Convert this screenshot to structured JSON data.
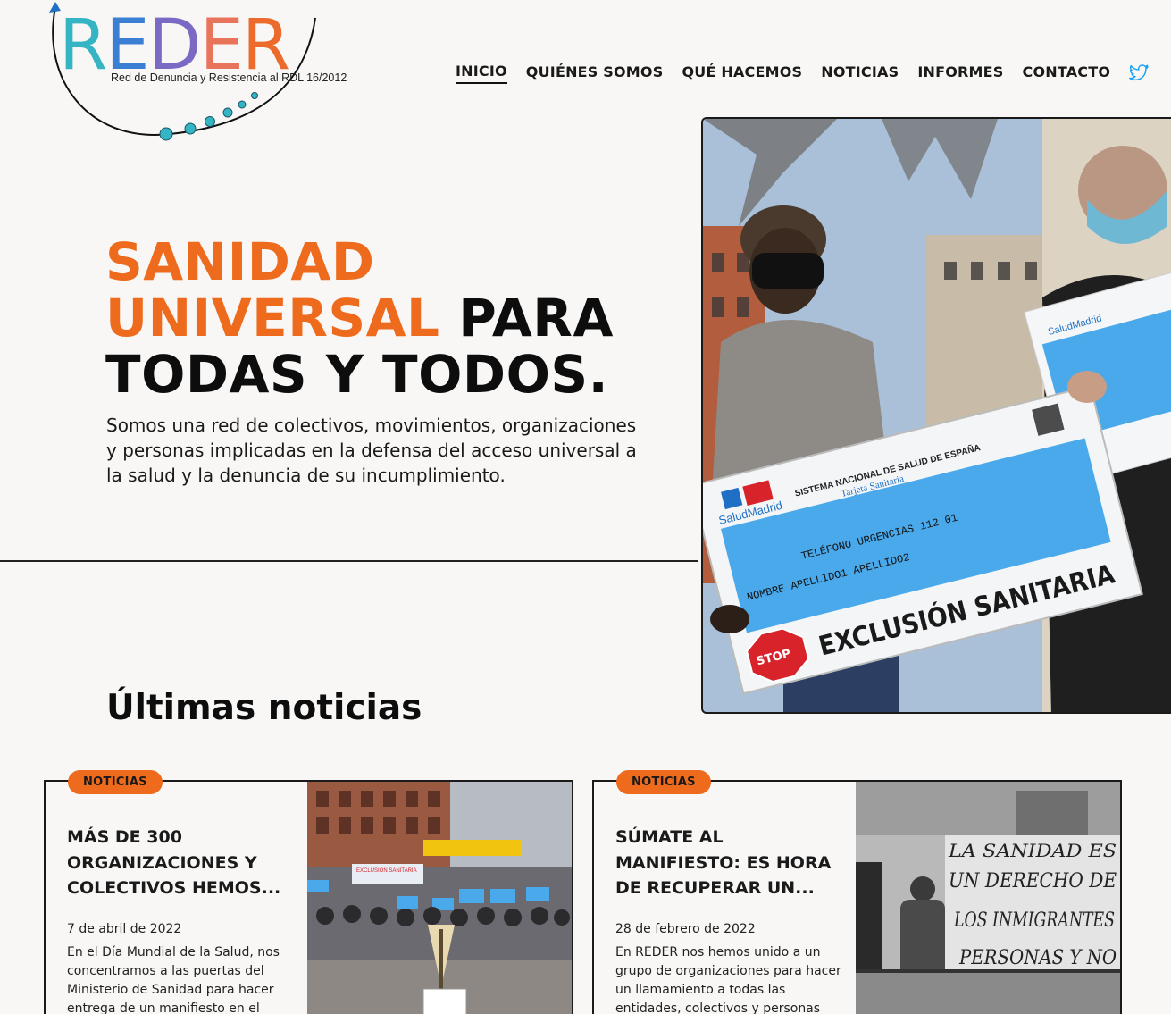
{
  "header": {
    "logo_letters": [
      {
        "char": "R",
        "color": "#35b5c4"
      },
      {
        "char": "E",
        "color": "#3a7fd4"
      },
      {
        "char": "D",
        "color": "#7a6ac4"
      },
      {
        "char": "E",
        "color": "#e8745c"
      },
      {
        "char": "R",
        "color": "#ec6a2b"
      }
    ],
    "logo_subtitle": "Red de Denuncia y Resistencia   al RDL 16/2012",
    "nav": [
      "INICIO",
      "QUIÉNES SOMOS",
      "QUÉ HACEMOS",
      "NOTICIAS",
      "INFORMES",
      "CONTACTO"
    ],
    "active_nav": "INICIO",
    "social_icon": "twitter-icon"
  },
  "hero": {
    "title_orange_1": "SANIDAD",
    "title_orange_2": "UNIVERSAL",
    "title_black_1": " PARA",
    "title_black_2": "TODAS Y TODOS.",
    "description": "Somos una red de colectivos, movimientos, organizaciones y personas implicadas en la defensa del acceso universal a la salud y la denuncia de su incumplimiento.",
    "image_sign": {
      "system": "SISTEMA NACIONAL DE SALUD DE ESPAÑA",
      "card": "Tarjeta Sanitaria",
      "brand": "SaludMadrid",
      "phone_line": "TELÉFONO URGENCIAS 112  01",
      "name_line": "NOMBRE APELLIDO1 APELLIDO2",
      "stop": "STOP",
      "slogan": "EXCLUSIÓN SANITARIA"
    }
  },
  "news": {
    "heading": "Últimas noticias",
    "items": [
      {
        "badge": "NOTICIAS",
        "title": "MÁS DE 300 ORGANIZACIONES Y COLECTIVOS HEMOS...",
        "date": "7 de abril de 2022",
        "excerpt": "En el Día Mundial de la Salud, nos concentramos a las puertas del Ministerio de Sanidad para hacer entrega de un manifiesto en el que...",
        "image_banner": "EXCLUSIÓN SANITARIA"
      },
      {
        "badge": "NOTICIAS",
        "title": "SÚMATE AL MANIFIESTO: ES HORA DE RECUPERAR UN...",
        "date": "28 de febrero de 2022",
        "excerpt": "En REDER nos hemos unido a un grupo de organizaciones para hacer un llamamiento a todas las entidades, colectivos y personas preocupadas...",
        "image_banner_1": "LA SANIDAD ES",
        "image_banner_2": "UN DERECHO DE",
        "image_banner_3": "LOS INMIGRANTES",
        "image_banner_4": "PERSONAS Y NO"
      }
    ]
  },
  "colors": {
    "accent": "#ee6a1c",
    "text": "#111111",
    "background": "#f8f7f5",
    "twitter": "#1da1f2"
  }
}
